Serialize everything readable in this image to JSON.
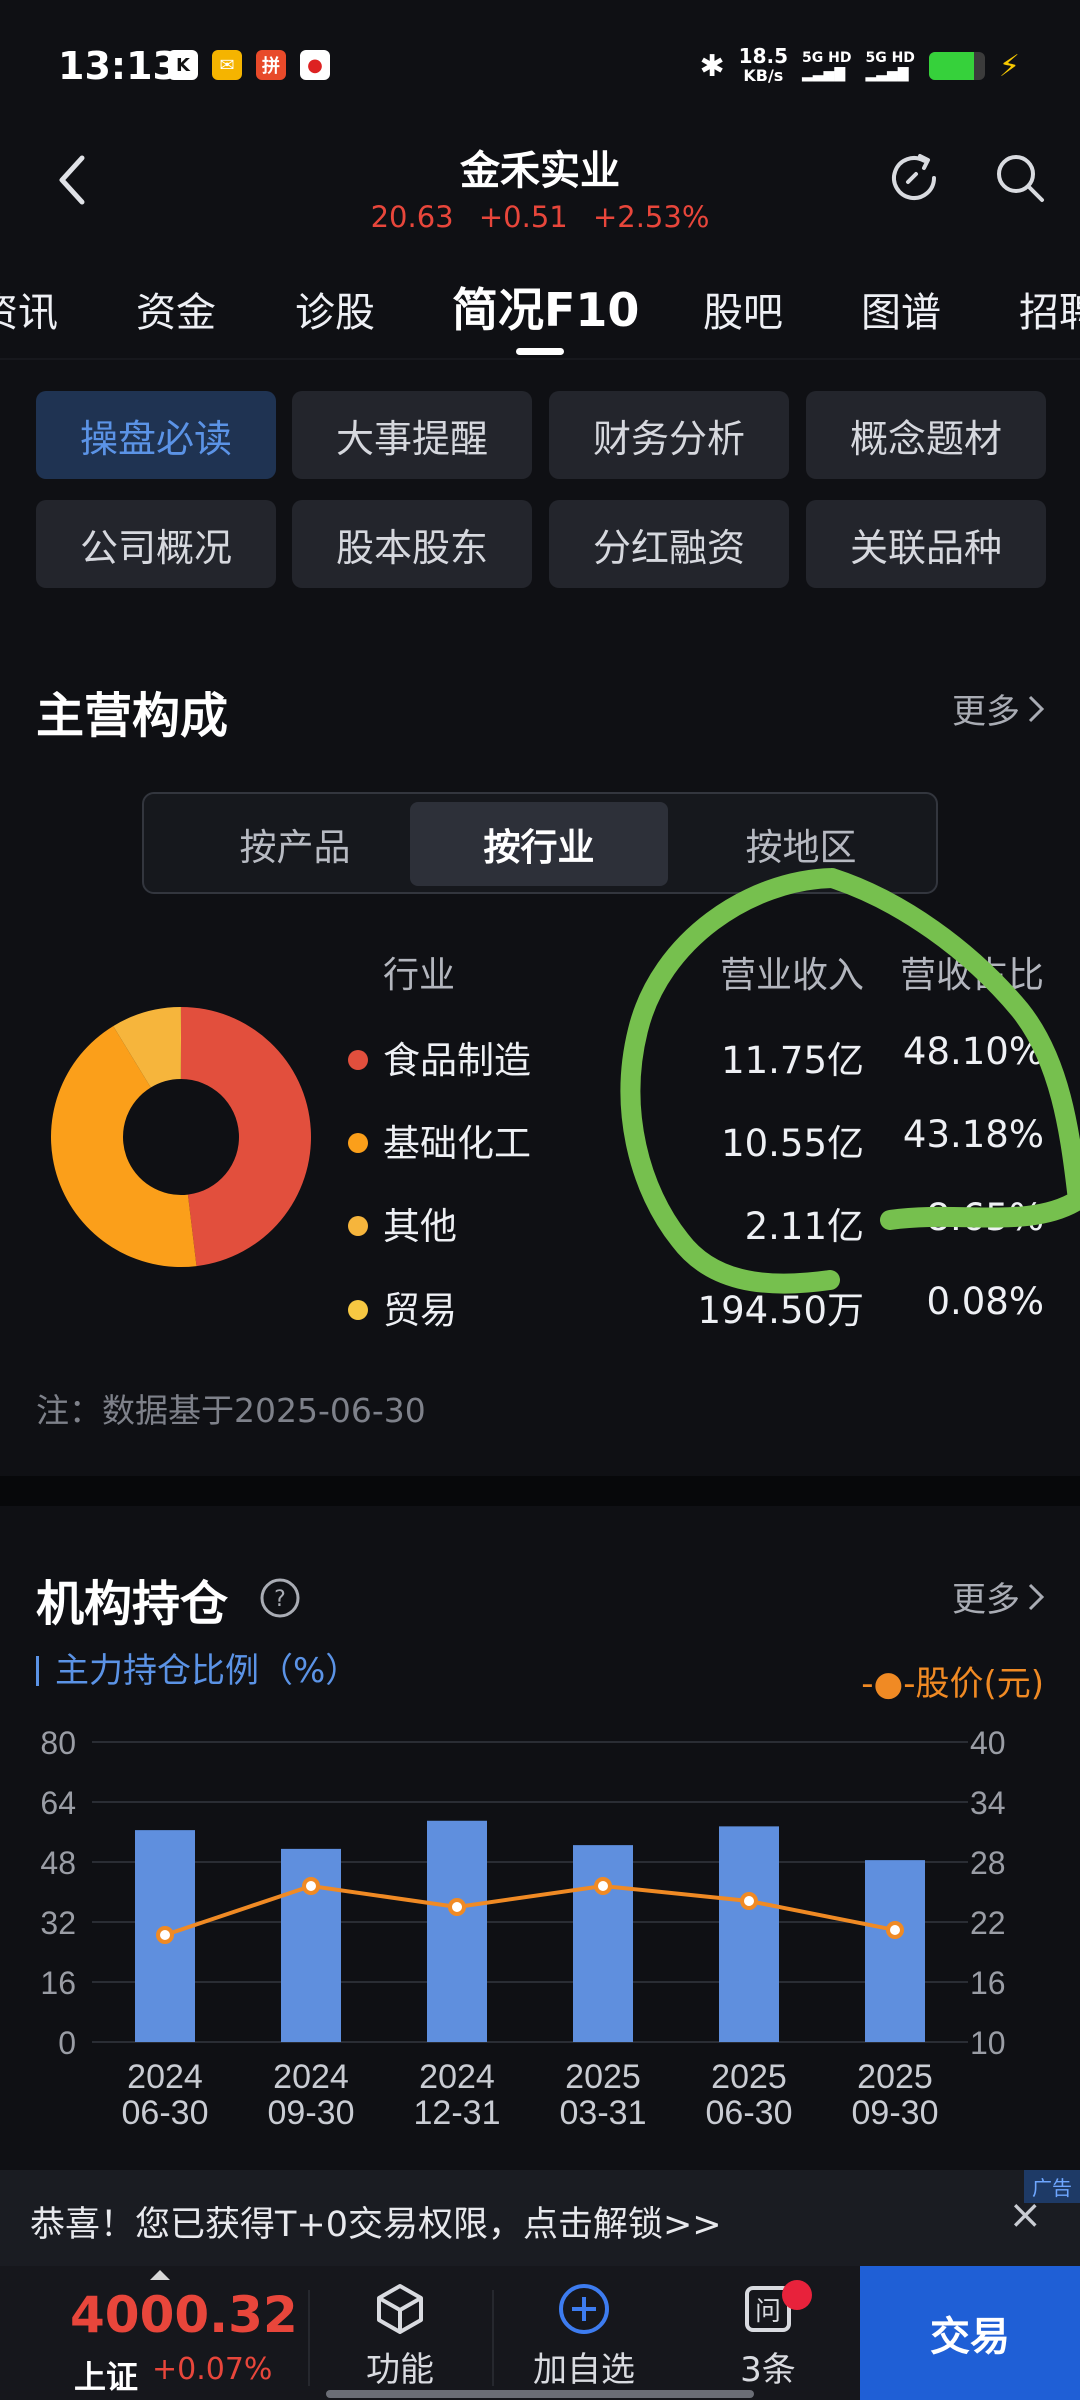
{
  "status_bar": {
    "time": "13:13",
    "speed_top": "18.5",
    "speed_bottom": "KB/s",
    "net1": "5G HD",
    "net2": "5G HD",
    "battery_level": 0.8
  },
  "header": {
    "title": "金禾实业",
    "price": "20.63",
    "change": "+0.51",
    "change_pct": "+2.53%"
  },
  "tabs": [
    "资讯",
    "资金",
    "诊股",
    "简况F10",
    "股吧",
    "图谱",
    "招聘"
  ],
  "active_tab": "简况F10",
  "grid_buttons": [
    "操盘必读",
    "大事提醒",
    "财务分析",
    "概念题材",
    "公司概况",
    "股本股东",
    "分红融资",
    "关联品种"
  ],
  "main_business": {
    "title": "主营构成",
    "more": "更多",
    "segments": [
      "按产品",
      "按行业",
      "按地区"
    ],
    "active_segment": "按行业",
    "headers": [
      "行业",
      "营业收入",
      "营收占比"
    ],
    "rows": [
      {
        "name": "食品制造",
        "revenue": "11.75亿",
        "share": "48.10%",
        "color": "#e24f3d",
        "pct": 48.1
      },
      {
        "name": "基础化工",
        "revenue": "10.55亿",
        "share": "43.18%",
        "color": "#fb9f1a",
        "pct": 43.18
      },
      {
        "name": "其他",
        "revenue": "2.11亿",
        "share": "8.65%",
        "color": "#f6b53c",
        "pct": 8.65
      },
      {
        "name": "贸易",
        "revenue": "194.50万",
        "share": "0.08%",
        "color": "#f7c842",
        "pct": 0.08
      }
    ],
    "note": "注：数据基于2025-06-30"
  },
  "institutional": {
    "title": "机构持仓",
    "help_icon": "question-icon",
    "more": "更多",
    "legend_left": "主力持仓比例（%）",
    "legend_right": "-●-股价(元)"
  },
  "chart_data": {
    "type": "bar",
    "categories": [
      "2024\n06-30",
      "2024\n09-30",
      "2024\n12-31",
      "2025\n03-31",
      "2025\n06-30",
      "2025\n09-30"
    ],
    "series": [
      {
        "name": "主力持仓比例（%）",
        "type": "bar",
        "values": [
          56.5,
          51.5,
          59,
          52.5,
          57.5,
          48.5
        ],
        "color": "#5f8fde"
      },
      {
        "name": "股价(元)",
        "type": "line",
        "values": [
          20.7,
          25.6,
          23.5,
          25.6,
          24.1,
          21.2
        ],
        "color": "#f08a24"
      }
    ],
    "y_left": {
      "ticks": [
        0,
        16,
        32,
        48,
        64,
        80
      ],
      "range": [
        0,
        80
      ]
    },
    "y_right": {
      "ticks": [
        10,
        16,
        22,
        28,
        34,
        40
      ],
      "range": [
        10,
        40
      ]
    },
    "grid": true
  },
  "banner": {
    "text": "恭喜！您已获得T+0交易权限，点击解锁>>",
    "ad_label": "广告",
    "close": "×"
  },
  "bottom_bar": {
    "index_value": "4000.32",
    "index_name": "上证",
    "index_change": "+0.07%",
    "func_label": "功能",
    "add_label": "加自选",
    "msg_label": "3条",
    "trade_label": "交易"
  }
}
